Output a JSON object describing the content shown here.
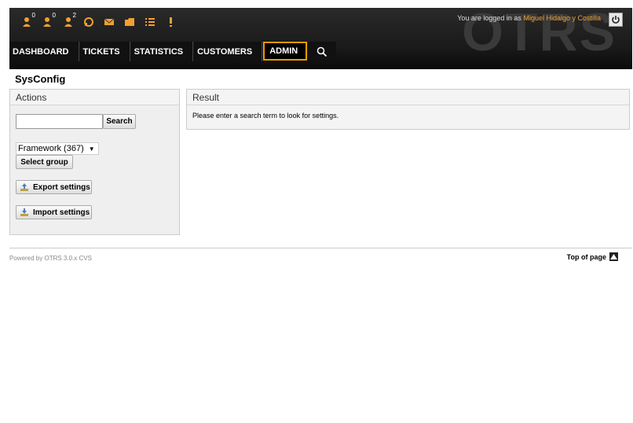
{
  "header": {
    "logo_text": "OTRS",
    "logged_in_prefix": "You are logged in as",
    "user_name": "Miguel Hidalgo y Costilla",
    "toolbar": [
      {
        "icon": "locked-tickets-icon",
        "count": "0",
        "color": "#f0a030"
      },
      {
        "icon": "watched-tickets-icon",
        "count": "0",
        "color": "#f0a030"
      },
      {
        "icon": "responsible-tickets-icon",
        "count": "2",
        "color": "#f0a030"
      },
      {
        "icon": "phone-ticket-icon",
        "count": "",
        "color": "#f0a030"
      },
      {
        "icon": "email-ticket-icon",
        "count": "",
        "color": "#f0a030"
      },
      {
        "icon": "queue-view-icon",
        "count": "",
        "color": "#f0a030"
      },
      {
        "icon": "status-view-icon",
        "count": "",
        "color": "#f0a030"
      },
      {
        "icon": "escalation-view-icon",
        "count": "",
        "color": "#f0a030"
      }
    ]
  },
  "nav": {
    "items": [
      "DASHBOARD",
      "TICKETS",
      "STATISTICS",
      "CUSTOMERS",
      "ADMIN"
    ],
    "active": "ADMIN",
    "accent": "#f29900"
  },
  "page": {
    "title": "SysConfig"
  },
  "sidebar": {
    "title": "Actions",
    "search_value": "",
    "search_button": "Search",
    "group_select": "Framework (367)",
    "select_group_button": "Select group",
    "export_button": "Export settings",
    "import_button": "Import settings"
  },
  "result": {
    "title": "Result",
    "message": "Please enter a search term to look for settings."
  },
  "footer": {
    "powered_by": "Powered by OTRS 3.0.x CVS",
    "top_of_page": "Top of page"
  }
}
